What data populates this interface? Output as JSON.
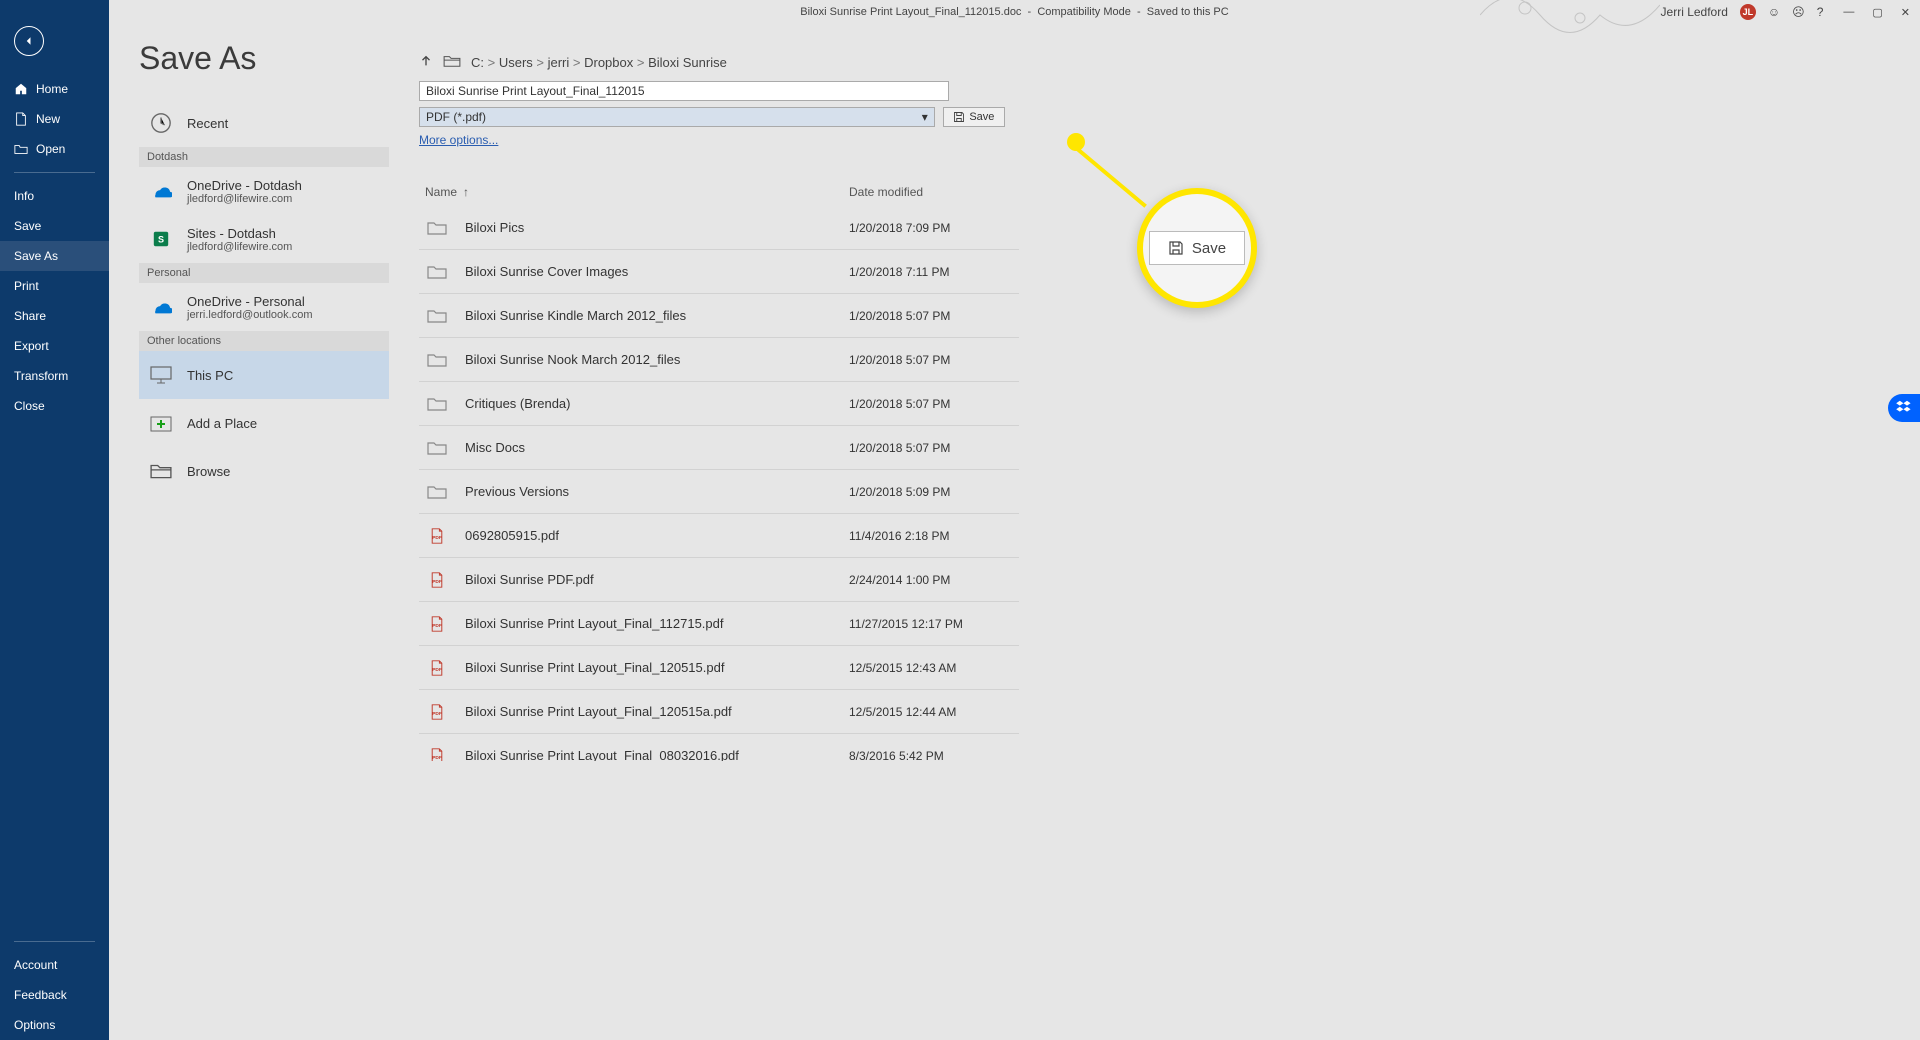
{
  "titlebar": {
    "doc": "Biloxi Sunrise Print Layout_Final_112015.doc",
    "mode": "Compatibility Mode",
    "saved": "Saved to this PC",
    "user": "Jerri Ledford",
    "initials": "JL"
  },
  "sidebar": {
    "items": [
      {
        "label": "Home"
      },
      {
        "label": "New"
      },
      {
        "label": "Open"
      },
      {
        "label": "Info"
      },
      {
        "label": "Save"
      },
      {
        "label": "Save As",
        "active": true
      },
      {
        "label": "Print"
      },
      {
        "label": "Share"
      },
      {
        "label": "Export"
      },
      {
        "label": "Transform"
      },
      {
        "label": "Close"
      }
    ],
    "bottom": [
      {
        "label": "Account"
      },
      {
        "label": "Feedback"
      },
      {
        "label": "Options"
      }
    ]
  },
  "page": {
    "title": "Save As"
  },
  "locations": {
    "recent": "Recent",
    "sections": [
      {
        "header": "Dotdash",
        "items": [
          {
            "icon": "onedrive",
            "title": "OneDrive - Dotdash",
            "sub": "jledford@lifewire.com"
          },
          {
            "icon": "sharepoint",
            "title": "Sites - Dotdash",
            "sub": "jledford@lifewire.com"
          }
        ]
      },
      {
        "header": "Personal",
        "items": [
          {
            "icon": "onedrive",
            "title": "OneDrive - Personal",
            "sub": "jerri.ledford@outlook.com"
          }
        ]
      },
      {
        "header": "Other locations",
        "items": [
          {
            "icon": "pc",
            "title": "This PC",
            "selected": true
          },
          {
            "icon": "place",
            "title": "Add a Place"
          },
          {
            "icon": "folder",
            "title": "Browse"
          }
        ]
      }
    ]
  },
  "breadcrumb": {
    "segments": [
      "C:",
      "Users",
      "jerri",
      "Dropbox",
      "Biloxi Sunrise"
    ]
  },
  "save": {
    "filename": "Biloxi Sunrise Print Layout_Final_112015",
    "format": "PDF (*.pdf)",
    "save_label": "Save",
    "more_options": "More options..."
  },
  "filelist": {
    "name_header": "Name",
    "date_header": "Date modified",
    "rows": [
      {
        "icon": "folder",
        "name": "Biloxi Pics",
        "date": "1/20/2018 7:09 PM"
      },
      {
        "icon": "folder",
        "name": "Biloxi Sunrise Cover Images",
        "date": "1/20/2018 7:11 PM"
      },
      {
        "icon": "folder",
        "name": "Biloxi Sunrise Kindle March 2012_files",
        "date": "1/20/2018 5:07 PM"
      },
      {
        "icon": "folder",
        "name": "Biloxi Sunrise Nook March 2012_files",
        "date": "1/20/2018 5:07 PM"
      },
      {
        "icon": "folder",
        "name": "Critiques (Brenda)",
        "date": "1/20/2018 5:07 PM"
      },
      {
        "icon": "folder",
        "name": "Misc Docs",
        "date": "1/20/2018 5:07 PM"
      },
      {
        "icon": "folder",
        "name": "Previous Versions",
        "date": "1/20/2018 5:09 PM"
      },
      {
        "icon": "pdf",
        "name": "0692805915.pdf",
        "date": "11/4/2016 2:18 PM"
      },
      {
        "icon": "pdf",
        "name": "Biloxi Sunrise PDF.pdf",
        "date": "2/24/2014 1:00 PM"
      },
      {
        "icon": "pdf",
        "name": "Biloxi Sunrise Print Layout_Final_112715.pdf",
        "date": "11/27/2015 12:17 PM"
      },
      {
        "icon": "pdf",
        "name": "Biloxi Sunrise Print Layout_Final_120515.pdf",
        "date": "12/5/2015 12:43 AM"
      },
      {
        "icon": "pdf",
        "name": "Biloxi Sunrise Print Layout_Final_120515a.pdf",
        "date": "12/5/2015 12:44 AM"
      },
      {
        "icon": "pdf",
        "name": "Biloxi Sunrise Print Layout_Final_08032016.pdf",
        "date": "8/3/2016 5:42 PM"
      }
    ]
  },
  "callout": {
    "save_label": "Save"
  }
}
